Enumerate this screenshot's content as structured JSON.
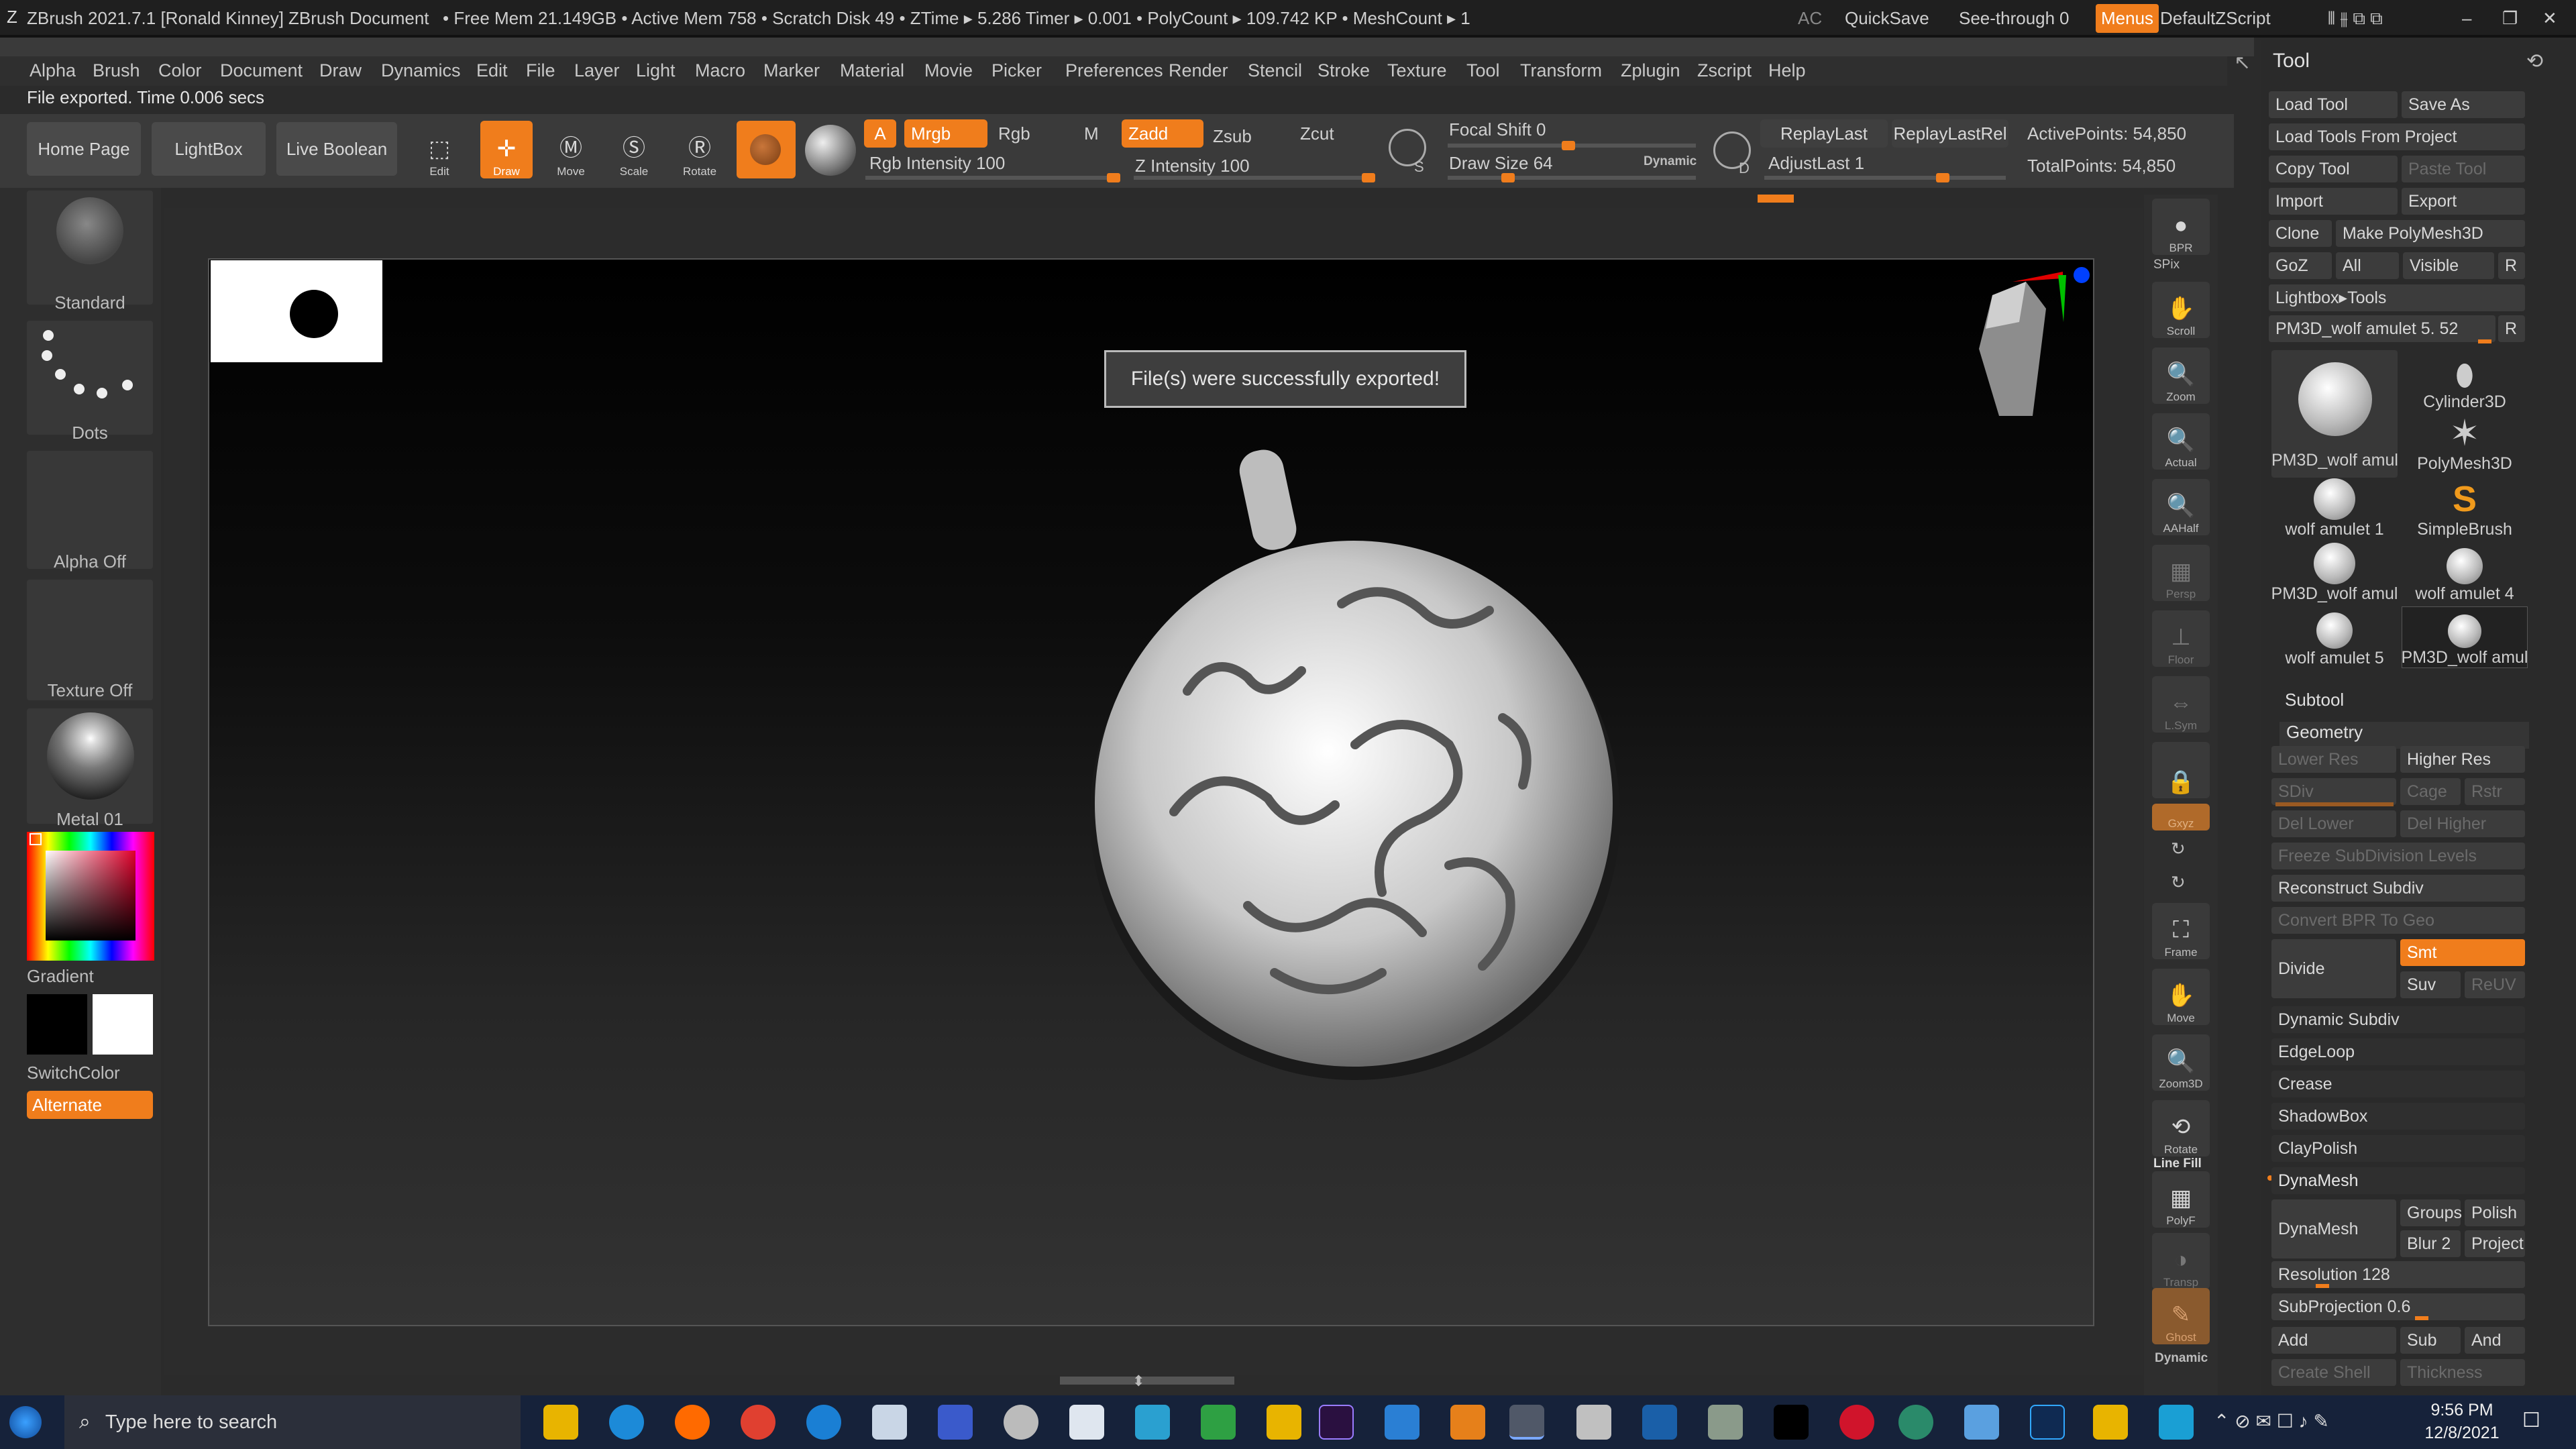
{
  "titlebar": {
    "app": "ZBrush 2021.7.1 [Ronald Kinney]",
    "document": "ZBrush Document",
    "stats": "• Free Mem 21.149GB • Active Mem 758 • Scratch Disk 49 • ZTime ▸ 5.286 Timer ▸ 0.001 • PolyCount ▸ 109.742 KP • MeshCount ▸ 1",
    "ac": "AC",
    "quicksave": "QuickSave",
    "seethrough_label": "See-through",
    "seethrough_value": "0",
    "menus": "Menus",
    "script": "DefaultZScript"
  },
  "menu": [
    "Alpha",
    "Brush",
    "Color",
    "Document",
    "Draw",
    "Dynamics",
    "Edit",
    "File",
    "Layer",
    "Light",
    "Macro",
    "Marker",
    "Material",
    "Movie",
    "Picker",
    "Preferences",
    "Render",
    "Stencil",
    "Stroke",
    "Texture",
    "Tool",
    "Transform",
    "Zplugin",
    "Zscript",
    "Help"
  ],
  "status_text": "File exported. Time 0.006 secs",
  "toolbar": {
    "home": "Home Page",
    "lightbox": "LightBox",
    "live_boolean": "Live Boolean",
    "edit": "Edit",
    "draw": "Draw",
    "move": "Move",
    "scale": "Scale",
    "rotate": "Rotate",
    "a": "A",
    "mrgb": "Mrgb",
    "rgb": "Rgb",
    "m": "M",
    "zadd": "Zadd",
    "zsub": "Zsub",
    "zcut": "Zcut",
    "rgb_intensity": "Rgb Intensity 100",
    "z_intensity": "Z Intensity 100",
    "rgb_intensity_level": 1.0,
    "z_intensity_level": 1.0,
    "focal_shift": "Focal Shift 0",
    "draw_size": "Draw Size 64",
    "dynamic": "Dynamic",
    "replay_last": "ReplayLast",
    "replay_last_rel": "ReplayLastRel",
    "adjust_last": "AdjustLast 1",
    "active_points": "ActivePoints: 54,850",
    "total_points": "TotalPoints: 54,850",
    "s_label": "S",
    "d_label": "D"
  },
  "left_shelf": {
    "brush": "Standard",
    "stroke": "Dots",
    "alpha": "Alpha Off",
    "texture": "Texture Off",
    "material": "Metal 01",
    "gradient": "Gradient",
    "switch_color": "SwitchColor",
    "alternate": "Alternate"
  },
  "canvas": {
    "notification": "File(s) were successfully exported!"
  },
  "right_shelf": [
    {
      "name": "bpr",
      "label": "BPR"
    },
    {
      "name": "spix",
      "label": "SPix"
    },
    {
      "name": "scroll",
      "label": "Scroll"
    },
    {
      "name": "zoom",
      "label": "Zoom"
    },
    {
      "name": "actual",
      "label": "Actual"
    },
    {
      "name": "aahalf",
      "label": "AAHalf"
    },
    {
      "name": "persp",
      "label": "Persp"
    },
    {
      "name": "floor",
      "label": "Floor"
    },
    {
      "name": "lsym",
      "label": "L.Sym"
    },
    {
      "name": "xyz",
      "label": "Gxyz"
    },
    {
      "name": "frame",
      "label": "Frame"
    },
    {
      "name": "move",
      "label": "Move"
    },
    {
      "name": "zoom3d",
      "label": "Zoom3D"
    },
    {
      "name": "rotate",
      "label": "Rotate"
    },
    {
      "name": "linefill",
      "label": "Line Fill"
    },
    {
      "name": "polyf",
      "label": "PolyF"
    },
    {
      "name": "transp",
      "label": "Transp"
    },
    {
      "name": "ghost",
      "label": "Ghost"
    },
    {
      "name": "dynamic",
      "label": "Dynamic"
    }
  ],
  "tool_panel": {
    "title": "Tool",
    "load_tool": "Load Tool",
    "save_as": "Save As",
    "load_from_project": "Load Tools From Project",
    "copy_tool": "Copy Tool",
    "paste_tool": "Paste Tool",
    "import": "Import",
    "export": "Export",
    "clone": "Clone",
    "make_polymesh": "Make PolyMesh3D",
    "goz": "GoZ",
    "all": "All",
    "visible": "Visible",
    "r": "R",
    "lightbox_tools": "Lightbox▸Tools",
    "current_tool": "PM3D_wolf amulet 5. 52",
    "thumbs": [
      "PM3D_wolf amul",
      "Cylinder3D",
      "PolyMesh3D",
      "wolf amulet 1",
      "SimpleBrush",
      "PM3D_wolf amul",
      "wolf amulet 4",
      "wolf amulet 5",
      "PM3D_wolf amul"
    ],
    "subtool": "Subtool",
    "geometry": "Geometry",
    "lower_res": "Lower Res",
    "higher_res": "Higher Res",
    "sdiv": "SDiv",
    "cage": "Cage",
    "rstr": "Rstr",
    "del_lower": "Del Lower",
    "del_higher": "Del Higher",
    "freeze": "Freeze SubDivision Levels",
    "reconstruct": "Reconstruct Subdiv",
    "convert_bpr": "Convert BPR To Geo",
    "divide": "Divide",
    "smt": "Smt",
    "suv": "Suv",
    "reuv": "ReUV",
    "dynamic_subdiv": "Dynamic Subdiv",
    "edgeloop": "EdgeLoop",
    "crease": "Crease",
    "shadowbox": "ShadowBox",
    "claypolish": "ClayPolish",
    "dynamesh": "DynaMesh",
    "dynamesh_btn": "DynaMesh",
    "groups": "Groups",
    "polish": "Polish",
    "blur": "Blur 2",
    "project": "Project",
    "resolution": "Resolution 128",
    "subprojection": "SubProjection 0.6",
    "add": "Add",
    "sub": "Sub",
    "and": "And",
    "create_shell": "Create Shell",
    "thickness": "Thickness"
  },
  "taskbar": {
    "search_placeholder": "Type here to search",
    "time": "9:56 PM",
    "date": "12/8/2021"
  }
}
